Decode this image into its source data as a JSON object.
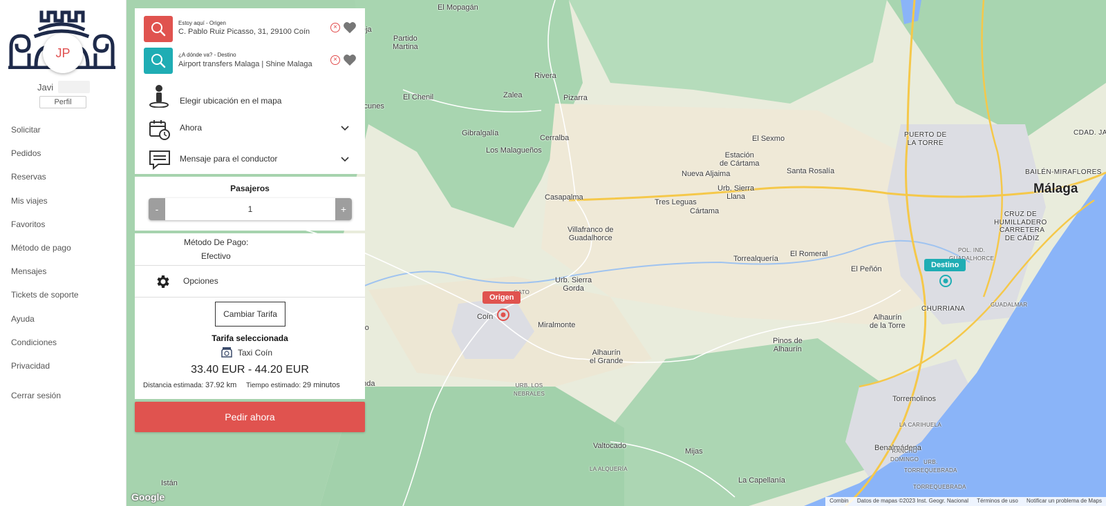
{
  "sidebar": {
    "avatar_initials": "JP",
    "user_name": "Javi",
    "profile_button": "Perfil",
    "nav": [
      "Solicitar",
      "Pedidos",
      "Reservas",
      "Mis viajes",
      "Favoritos",
      "Método de pago",
      "Mensajes",
      "Tickets de soporte",
      "Ayuda",
      "Condiciones",
      "Privacidad"
    ],
    "logout": "Cerrar sesión"
  },
  "route": {
    "origin_caption": "Estoy aquí - Origen",
    "origin_address": "C. Pablo Ruiz Picasso, 31, 29100 Coín",
    "destination_caption": "¿A dónde va? - Destino",
    "destination_address": "Airport transfers Malaga | Shine Malaga",
    "choose_on_map": "Elegir ubicación en el mapa",
    "when": "Ahora",
    "driver_message": "Mensaje para el conductor"
  },
  "passengers": {
    "title": "Pasajeros",
    "minus": "-",
    "plus": "+",
    "value": "1"
  },
  "payment": {
    "label": "Método De Pago:",
    "value": "Efectivo",
    "options": "Opciones"
  },
  "tariff": {
    "change_button": "Cambiar Tarifa",
    "selected_title": "Tarifa seleccionada",
    "name": "Taxi Coín",
    "price": "33.40 EUR - 44.20 EUR",
    "distance_label": "Distancia estimada:",
    "distance_value": "37.92 km",
    "time_label": "Tiempo estimado:",
    "time_value": "29 minutos"
  },
  "order_button": "Pedir ahora",
  "map": {
    "origin_marker": "Origen",
    "destination_marker": "Destino",
    "google": "Google",
    "credits": [
      "Combin",
      "Datos de mapas ©2023 Inst. Geogr. Nacional",
      "Términos de uso",
      "Notificar un problema de Maps"
    ],
    "places": [
      {
        "name": "El Mopagán",
        "cls": ""
      },
      {
        "name": "Partido\nMartina",
        "cls": ""
      },
      {
        "name": "Rivera",
        "cls": ""
      },
      {
        "name": "Zalea",
        "cls": ""
      },
      {
        "name": "Pizarra",
        "cls": ""
      },
      {
        "name": "El Chenil",
        "cls": ""
      },
      {
        "name": "aicunes",
        "cls": ""
      },
      {
        "name": "eja",
        "cls": ""
      },
      {
        "name": "Gibralgalía",
        "cls": ""
      },
      {
        "name": "Cerralba",
        "cls": ""
      },
      {
        "name": "Los Malagueños",
        "cls": ""
      },
      {
        "name": "El Sexmo",
        "cls": ""
      },
      {
        "name": "Estación\nde Cártama",
        "cls": ""
      },
      {
        "name": "Nueva Aljaima",
        "cls": ""
      },
      {
        "name": "Santa Rosalía",
        "cls": ""
      },
      {
        "name": "Urb. Sierra\nLlana",
        "cls": ""
      },
      {
        "name": "Casapalma",
        "cls": ""
      },
      {
        "name": "Tres Leguas",
        "cls": ""
      },
      {
        "name": "Cártama",
        "cls": ""
      },
      {
        "name": "PUERTO DE\nLA TORRE",
        "cls": "upper"
      },
      {
        "name": "CDAD. JARDÍN",
        "cls": "upper"
      },
      {
        "name": "BAILÉN-MIRAFLORES",
        "cls": "upper"
      },
      {
        "name": "Málaga",
        "cls": "big"
      },
      {
        "name": "CRUZ DE\nHUMILLADERO",
        "cls": "upper"
      },
      {
        "name": "CARRETERA\nDE CÁDIZ",
        "cls": "upper"
      },
      {
        "name": "Villafranco de\nGuadalhorce",
        "cls": ""
      },
      {
        "name": "Torrealquería",
        "cls": ""
      },
      {
        "name": "El Romeral",
        "cls": ""
      },
      {
        "name": "El Peñón",
        "cls": ""
      },
      {
        "name": "POL. IND.\nGUADALHORCE",
        "cls": "small"
      },
      {
        "name": "Urb. Sierra\nGorda",
        "cls": ""
      },
      {
        "name": "GATO",
        "cls": "small"
      },
      {
        "name": "CHURRIANA",
        "cls": "upper"
      },
      {
        "name": "GUADALMAR",
        "cls": "small"
      },
      {
        "name": "Coín",
        "cls": ""
      },
      {
        "name": "Miralmonte",
        "cls": ""
      },
      {
        "name": "Alhaurín\nde la Torre",
        "cls": ""
      },
      {
        "name": "aro",
        "cls": ""
      },
      {
        "name": "Pinos de\nAlhaurín",
        "cls": ""
      },
      {
        "name": "Alhaurín\nel Grande",
        "cls": ""
      },
      {
        "name": "onda",
        "cls": ""
      },
      {
        "name": "URB. LOS\nNEBRALES",
        "cls": "small"
      },
      {
        "name": "Torremolinos",
        "cls": ""
      },
      {
        "name": "LA CARIHUELA",
        "cls": "small"
      },
      {
        "name": "Valtocado",
        "cls": ""
      },
      {
        "name": "Mijas",
        "cls": ""
      },
      {
        "name": "Benalmádena",
        "cls": ""
      },
      {
        "name": "RANCHO\nDOMINGO",
        "cls": "small"
      },
      {
        "name": "URB.\nTORREQUEBRADA",
        "cls": "small"
      },
      {
        "name": "TORREQUEBRADA",
        "cls": "small"
      },
      {
        "name": "LA ALQUERÍA",
        "cls": "small"
      },
      {
        "name": "Istán",
        "cls": ""
      },
      {
        "name": "La Capellanía",
        "cls": ""
      }
    ]
  },
  "colors": {
    "accent_red": "#e0534f",
    "accent_teal": "#1fadb4",
    "water": "#8ab4f8",
    "forest": "#a8d5b0",
    "land": "#eee8d6"
  }
}
